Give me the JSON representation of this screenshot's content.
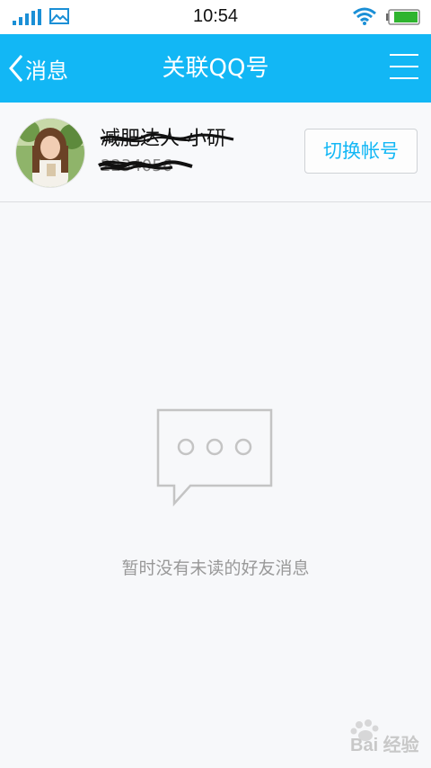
{
  "status_bar": {
    "time": "10:54"
  },
  "nav": {
    "back_label": "消息",
    "title": "关联QQ号"
  },
  "account": {
    "name": "减肥达人-小研",
    "number": "2234056",
    "switch_label": "切换帐号"
  },
  "empty": {
    "text": "暂时没有未读的好友消息"
  },
  "watermark": {
    "text": "Bai 经验"
  },
  "colors": {
    "accent": "#12b7f5",
    "background": "#f7f8fa",
    "hint_text": "#999999"
  }
}
